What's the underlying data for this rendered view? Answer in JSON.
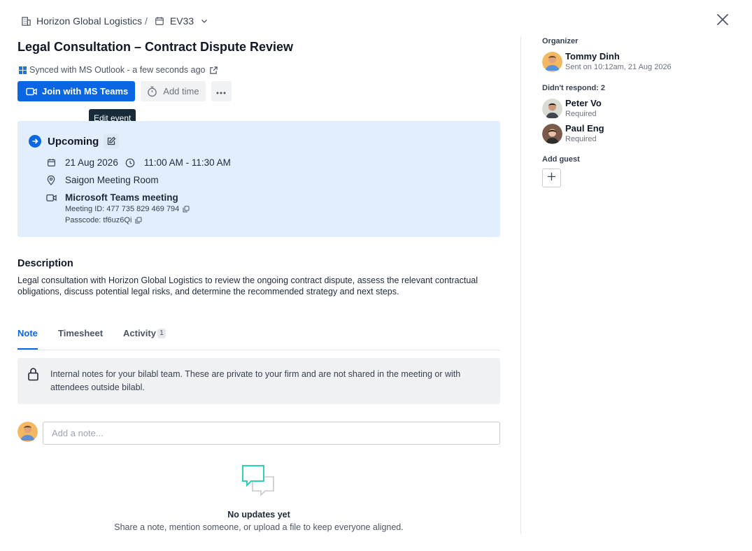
{
  "breadcrumb": {
    "company": "Horizon Global Logistics",
    "separator": "/",
    "event_code": "EV33"
  },
  "event": {
    "title": "Legal Consultation – Contract Dispute Review",
    "synced_text": "Synced with MS Outlook - a few seconds ago",
    "status": "Upcoming",
    "date": "21 Aug 2026",
    "time": "11:00 AM - 11:30 AM",
    "location": "Saigon Meeting Room",
    "meeting_title": "Microsoft Teams meeting",
    "meeting_id_line": "Meeting ID: 477 735 829 469 794",
    "passcode_line": "Passcode: tf6uz6Qi"
  },
  "actions": {
    "join_label": "Join with MS Teams",
    "add_time_label": "Add time",
    "edit_tooltip": "Edit event"
  },
  "description": {
    "heading": "Description",
    "text": "Legal consultation with Horizon Global Logistics to review the ongoing contract dispute, assess the relevant contractual obligations, discuss potential legal risks, and determine the recommended strategy and next steps."
  },
  "tabs": [
    {
      "label": "Note",
      "active": true
    },
    {
      "label": "Timesheet",
      "active": false
    },
    {
      "label": "Activity",
      "active": false,
      "count": "1"
    }
  ],
  "notice": {
    "text": "Internal notes for your bilabl team. These are private to your firm and are not shared in the meeting or with attendees outside bilabl."
  },
  "note_input": {
    "placeholder": "Add a note..."
  },
  "empty_state": {
    "title": "No updates yet",
    "subtitle": "Share a note, mention someone, or upload a file to keep everyone aligned."
  },
  "sidebar": {
    "organizer_label": "Organizer",
    "organizer": {
      "name": "Tommy Dinh",
      "sub": "Sent on 10:12am, 21 Aug 2026"
    },
    "no_response_label": "Didn't respond: 2",
    "guests": [
      {
        "name": "Peter Vo",
        "sub": "Required"
      },
      {
        "name": "Paul Eng",
        "sub": "Required"
      }
    ],
    "add_guest_label": "Add guest"
  },
  "colors": {
    "accent": "#0b66e4",
    "card_bg": "#e3eefc",
    "tooltip_bg": "#172b3a",
    "chat_icon": "#2ad4b3"
  }
}
